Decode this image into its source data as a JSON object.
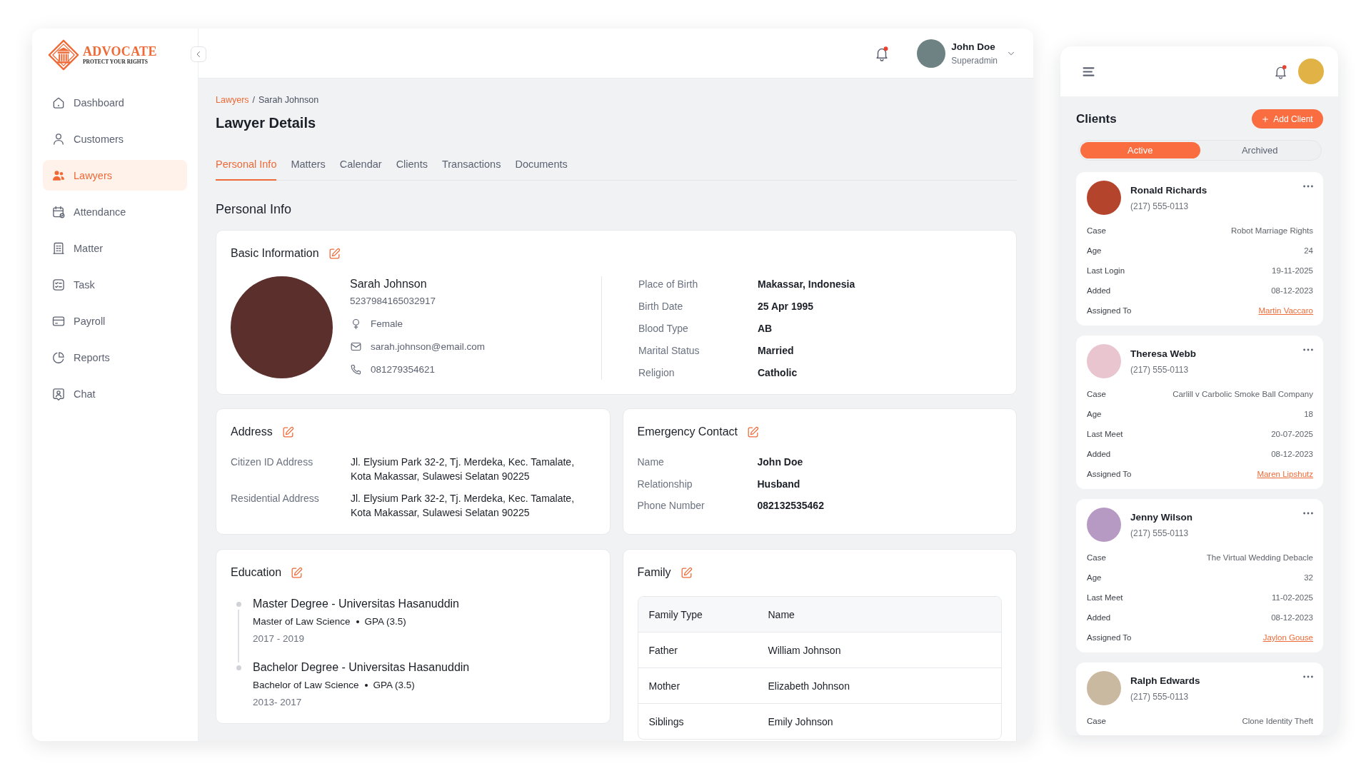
{
  "sidebar": {
    "logo": {
      "name": "ADVOCATE",
      "tagline": "PROTECT YOUR RIGHTS"
    },
    "items": [
      {
        "label": "Dashboard",
        "selected": false
      },
      {
        "label": "Customers",
        "selected": false
      },
      {
        "label": "Lawyers",
        "selected": true
      },
      {
        "label": "Attendance",
        "selected": false
      },
      {
        "label": "Matter",
        "selected": false
      },
      {
        "label": "Task",
        "selected": false
      },
      {
        "label": "Payroll",
        "selected": false
      },
      {
        "label": "Reports",
        "selected": false
      },
      {
        "label": "Chat",
        "selected": false
      }
    ]
  },
  "header": {
    "notification": {
      "unread": true
    },
    "user": {
      "name": "John Doe",
      "role": "Superadmin"
    }
  },
  "breadcrumb": {
    "items": [
      {
        "label": "Lawyers"
      },
      {
        "label": "Sarah Johnson"
      }
    ],
    "separator": "/"
  },
  "page_title": "Lawyer Details",
  "tabs": [
    {
      "label": "Personal Info",
      "selected": true
    },
    {
      "label": "Matters",
      "selected": false
    },
    {
      "label": "Calendar",
      "selected": false
    },
    {
      "label": "Clients",
      "selected": false
    },
    {
      "label": "Transactions",
      "selected": false
    },
    {
      "label": "Documents",
      "selected": false
    }
  ],
  "section_title": "Personal Info",
  "basic_information": {
    "title": "Basic Information",
    "profile": {
      "name": "Sarah Johnson",
      "id_number": "5237984165032917",
      "gender": "Female",
      "email": "sarah.johnson@email.com",
      "phone": "081279354621"
    },
    "details": [
      {
        "label": "Place of Birth",
        "value": "Makassar, Indonesia"
      },
      {
        "label": "Birth Date",
        "value": "25 Apr 1995"
      },
      {
        "label": "Blood Type",
        "value": "AB"
      },
      {
        "label": "Marital Status",
        "value": "Married"
      },
      {
        "label": "Religion",
        "value": "Catholic"
      }
    ]
  },
  "address": {
    "title": "Address",
    "rows": [
      {
        "label": "Citizen ID Address",
        "value": "Jl. Elysium Park 32-2, Tj. Merdeka, Kec. Tamalate, Kota Makassar, Sulawesi Selatan 90225"
      },
      {
        "label": "Residential Address",
        "value": "Jl. Elysium Park 32-2, Tj. Merdeka, Kec. Tamalate, Kota Makassar, Sulawesi Selatan 90225"
      }
    ]
  },
  "emergency_contact": {
    "title": "Emergency Contact",
    "rows": [
      {
        "label": "Name",
        "value": "John Doe"
      },
      {
        "label": "Relationship",
        "value": "Husband"
      },
      {
        "label": "Phone Number",
        "value": "082132535462"
      }
    ]
  },
  "education": {
    "title": "Education",
    "entries": [
      {
        "title": "Master Degree - Universitas Hasanuddin",
        "program": "Master of Law Science",
        "gpa": "GPA (3.5)",
        "years": "2017 - 2019"
      },
      {
        "title": "Bachelor Degree - Universitas Hasanuddin",
        "program": "Bachelor of Law Science",
        "gpa": "GPA (3.5)",
        "years": "2013- 2017"
      }
    ]
  },
  "family": {
    "title": "Family",
    "columns": [
      "Family Type",
      "Name"
    ],
    "rows": [
      {
        "type": "Father",
        "name": "William Johnson"
      },
      {
        "type": "Mother",
        "name": "Elizabeth Johnson"
      },
      {
        "type": "Siblings",
        "name": "Emily Johnson"
      }
    ]
  },
  "clients_panel": {
    "notification": {
      "unread": true
    },
    "title": "Clients",
    "add_button": "Add Client",
    "filters": [
      {
        "label": "Active",
        "selected": true
      },
      {
        "label": "Archived",
        "selected": false
      }
    ],
    "clients": [
      {
        "name": "Ronald Richards",
        "phone": "(217) 555-0113",
        "fields": [
          {
            "label": "Case",
            "value": "Robot Marriage Rights",
            "kind": "text"
          },
          {
            "label": "Age",
            "value": "24",
            "kind": "text"
          },
          {
            "label": "Last Login",
            "value": "19-11-2025",
            "kind": "text"
          },
          {
            "label": "Added",
            "value": "08-12-2023",
            "kind": "text"
          },
          {
            "label": "Assigned To",
            "value": "Martin Vaccaro",
            "kind": "link"
          }
        ]
      },
      {
        "name": "Theresa Webb",
        "phone": "(217) 555-0113",
        "fields": [
          {
            "label": "Case",
            "value": "Carlill v Carbolic Smoke Ball Company",
            "kind": "text"
          },
          {
            "label": "Age",
            "value": "18",
            "kind": "text"
          },
          {
            "label": "Last Meet",
            "value": "20-07-2025",
            "kind": "text"
          },
          {
            "label": "Added",
            "value": "08-12-2023",
            "kind": "text"
          },
          {
            "label": "Assigned To",
            "value": "Maren Lipshutz",
            "kind": "link"
          }
        ]
      },
      {
        "name": "Jenny Wilson",
        "phone": "(217) 555-0113",
        "fields": [
          {
            "label": "Case",
            "value": "The Virtual Wedding Debacle",
            "kind": "text"
          },
          {
            "label": "Age",
            "value": "32",
            "kind": "text"
          },
          {
            "label": "Last Meet",
            "value": "11-02-2025",
            "kind": "text"
          },
          {
            "label": "Added",
            "value": "08-12-2023",
            "kind": "text"
          },
          {
            "label": "Assigned To",
            "value": "Jaylon Gouse",
            "kind": "link"
          }
        ]
      },
      {
        "name": "Ralph Edwards",
        "phone": "(217) 555-0113",
        "fields": [
          {
            "label": "Case",
            "value": "Clone Identity Theft",
            "kind": "text"
          }
        ]
      }
    ]
  }
}
